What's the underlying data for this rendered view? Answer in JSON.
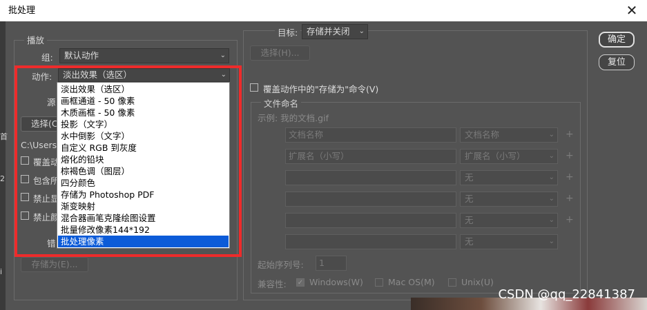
{
  "window": {
    "title": "批处理"
  },
  "play": {
    "legend": "播放",
    "group_label": "组:",
    "group_value": "默认动作",
    "action_label": "动作:",
    "action_value": "淡出效果（选区）",
    "source_label": "源",
    "choose_label": "选择(C",
    "path_text": "C:\\Users\\",
    "checkboxes": [
      "覆盖动",
      "包含所",
      "禁止显",
      "禁止颜"
    ],
    "error_label": "错",
    "saveas_label": "存储为(E)..."
  },
  "action_menu": {
    "items": [
      "淡出效果（选区）",
      "画框通道 - 50 像素",
      "木质画框 - 50 像素",
      "投影（文字）",
      "水中倒影（文字）",
      "自定义 RGB 到灰度",
      "熔化的铅块",
      "棕褐色调（图层）",
      "四分颜色",
      "存储为 Photoshop PDF",
      "渐变映射",
      "混合器画笔克隆绘图设置",
      "批量修改像素144*192",
      "批处理像素"
    ],
    "selected_index": 13
  },
  "target": {
    "label": "目标:",
    "value": "存储并关闭",
    "choose_button": "选择(H)...",
    "override_checkbox": "覆盖动作中的\"存储为\"命令(V)"
  },
  "file_naming": {
    "legend": "文件命名",
    "example": "示例: 我的文档.gif",
    "rows": [
      {
        "input": "文档名称",
        "select": "文档名称"
      },
      {
        "input": "扩展名（小写）",
        "select": "扩展名（小写）"
      },
      {
        "input": "",
        "select": "无"
      },
      {
        "input": "",
        "select": "无"
      },
      {
        "input": "",
        "select": "无"
      },
      {
        "input": "",
        "select": "无"
      }
    ],
    "plus": "+",
    "start_serial_label": "起始序列号:",
    "start_serial_value": "1",
    "compat_label": "兼容性:",
    "compat": [
      {
        "label": "Windows(W)",
        "checked": true
      },
      {
        "label": "Mac OS(M)",
        "checked": false
      },
      {
        "label": "Unix(U)",
        "checked": false
      }
    ]
  },
  "buttons": {
    "ok": "确定",
    "reset": "复位"
  },
  "left_edge_glyphs": [
    "首",
    "2",
    "i"
  ],
  "watermark": "CSDN @qq_22841387",
  "colors": {
    "dialog_bg": "#535353",
    "highlight": "#0c5bd8",
    "annotation_red": "#ee2b2b"
  }
}
